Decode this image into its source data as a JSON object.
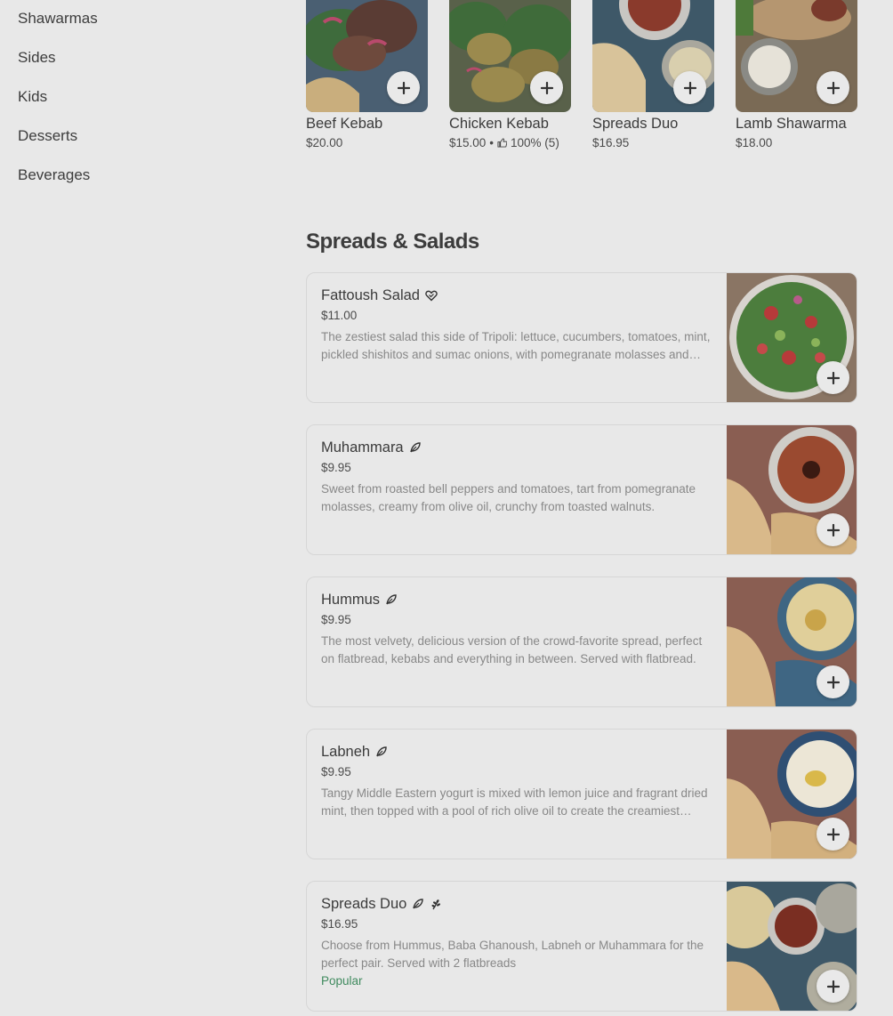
{
  "sidebar": {
    "items": [
      {
        "label": "Shawarmas"
      },
      {
        "label": "Sides"
      },
      {
        "label": "Kids"
      },
      {
        "label": "Desserts"
      },
      {
        "label": "Beverages"
      }
    ]
  },
  "featured": [
    {
      "name": "Beef Kebab",
      "price": "$20.00"
    },
    {
      "name": "Chicken Kebab",
      "price": "$15.00",
      "rating_sep": "•",
      "rating": "100% (5)"
    },
    {
      "name": "Spreads Duo",
      "price": "$16.95"
    },
    {
      "name": "Lamb Shawarma",
      "price": "$18.00"
    }
  ],
  "section": {
    "title": "Spreads & Salads"
  },
  "items": [
    {
      "name": "Fattoush Salad",
      "badge_icon": "heart-icon",
      "price": "$11.00",
      "description": "The zestiest salad this side of Tripoli: lettuce, cucumbers, tomatoes, mint, pickled shishitos and sumac onions, with pomegranate molasses and crispy pita chips."
    },
    {
      "name": "Muhammara",
      "badge_icon": "leaf-icon",
      "price": "$9.95",
      "description": "Sweet from roasted bell peppers and tomatoes, tart from pomegranate molasses, creamy from olive oil, crunchy from toasted walnuts."
    },
    {
      "name": "Hummus",
      "badge_icon": "leaf-icon",
      "price": "$9.95",
      "description": "The most velvety, delicious version of the crowd-favorite spread, perfect on flatbread, kebabs and everything in between. Served with flatbread."
    },
    {
      "name": "Labneh",
      "badge_icon": "leaf-icon",
      "price": "$9.95",
      "description": "Tangy Middle Eastern yogurt is mixed with lemon juice and fragrant dried mint, then topped with a pool of rich olive oil to create the creamiest spread."
    },
    {
      "name": "Spreads Duo",
      "badge_icon": "leaf-icon",
      "badge_icon_2": "wheat-icon",
      "price": "$16.95",
      "description": "Choose from Hummus, Baba Ghanoush, Labneh or Muhammara for the perfect pair. Served with 2 flatbreads",
      "tag": "Popular"
    }
  ],
  "colors": {
    "background": "#e8e8e8",
    "popular_tag": "#3f8a5e"
  }
}
